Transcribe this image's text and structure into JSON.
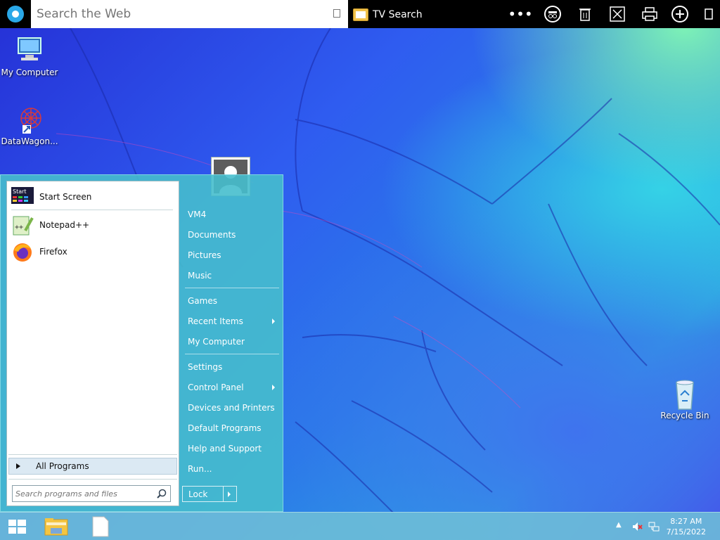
{
  "toolbar": {
    "search_placeholder": "Search the Web",
    "tv_search_label": "TV Search",
    "tools": [
      "more-icon",
      "incognito-icon",
      "trash-icon",
      "scissors-icon",
      "printer-icon",
      "plus-icon",
      "window-icon"
    ]
  },
  "desktop": {
    "icons": [
      {
        "label": "My Computer",
        "icon": "computer-icon"
      },
      {
        "label": "DataWagon...",
        "icon": "datawagon-icon"
      },
      {
        "label": "Recycle Bin",
        "icon": "recycle-bin-icon"
      }
    ]
  },
  "start_menu": {
    "pinned": [
      {
        "label": "Start Screen",
        "icon": "start-screen-icon"
      },
      {
        "label": "Notepad++",
        "icon": "notepadpp-icon"
      },
      {
        "label": "Firefox",
        "icon": "firefox-icon"
      }
    ],
    "all_programs": "All Programs",
    "search_placeholder": "Search programs and files",
    "right_items": [
      {
        "label": "VM4"
      },
      {
        "label": "Documents"
      },
      {
        "label": "Pictures"
      },
      {
        "label": "Music"
      },
      {
        "label": "Games"
      },
      {
        "label": "Recent Items",
        "submenu": true
      },
      {
        "label": "My Computer"
      },
      {
        "label": "Settings"
      },
      {
        "label": "Control Panel",
        "submenu": true
      },
      {
        "label": "Devices and Printers"
      },
      {
        "label": "Default Programs"
      },
      {
        "label": "Help and Support"
      },
      {
        "label": "Run..."
      }
    ],
    "lock_label": "Lock"
  },
  "taskbar": {
    "time": "8:27 AM",
    "date": "7/15/2022",
    "pinned": [
      "start-button",
      "file-explorer-icon",
      "blank-document-icon"
    ]
  },
  "colors": {
    "start_menu_bg": "#46bec9",
    "taskbar_bg": "#6ebed7",
    "toolbar_bg": "#000000"
  }
}
